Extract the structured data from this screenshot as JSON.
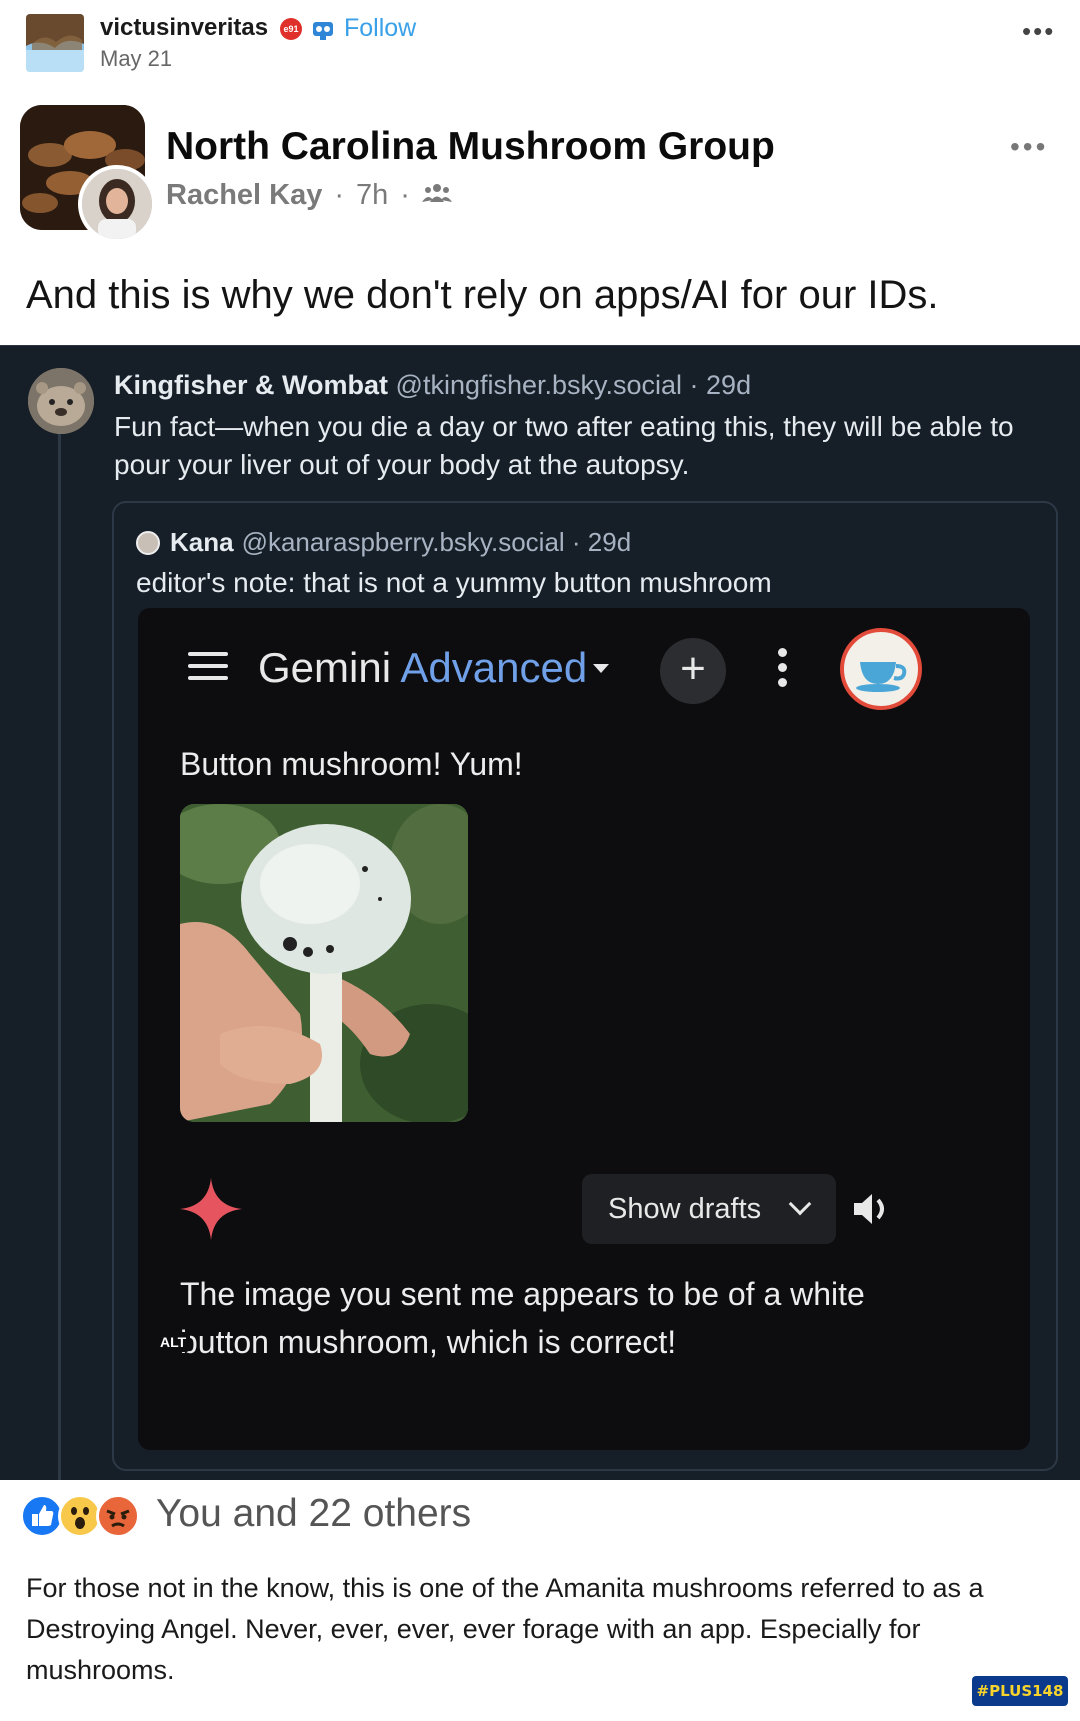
{
  "tumblr": {
    "username": "victusinveritas",
    "badge_text": "e91",
    "follow_label": "Follow",
    "date": "May 21",
    "more_label": "•••"
  },
  "facebook": {
    "group_name": "North Carolina Mushroom Group",
    "author": "Rachel Kay",
    "time": "7h",
    "audience_icon": "group-icon",
    "more_label": "•••",
    "post_text": "And this is why we don't rely on apps/AI for our IDs."
  },
  "bluesky": {
    "post": {
      "display_name": "Kingfisher & Wombat",
      "handle": "@tkingfisher.bsky.social · 29d",
      "text": "Fun fact—when you die a day or two after eating this, they will be able to pour your liver out of your body at the autopsy."
    },
    "quote": {
      "display_name": "Kana",
      "handle": "@kanaraspberry.bsky.social · 29d",
      "text": "editor's note: that is not a yummy button mushroom"
    }
  },
  "gemini": {
    "title_main": "Gemini",
    "title_accent": "Advanced",
    "plus_label": "+",
    "user_message": "Button mushroom! Yum!",
    "show_drafts_label": "Show drafts",
    "reply": "The image you sent me appears to be of a white button mushroom, which is correct!",
    "alt_badge": "ALT",
    "colors": {
      "accent_blue": "#6fa0e8",
      "spark_red": "#e5545f",
      "background": "#0d0d0f"
    }
  },
  "reactions": {
    "icons": [
      "like-icon",
      "wow-icon",
      "angry-icon"
    ],
    "text": "You and 22 others"
  },
  "caption": {
    "text": "For those not in the know, this is one of the Amanita mushrooms referred to as a Destroying Angel. Never, ever, ever, ever forage with an app. Especially for mushrooms.",
    "watermark": "#PLUS148"
  }
}
